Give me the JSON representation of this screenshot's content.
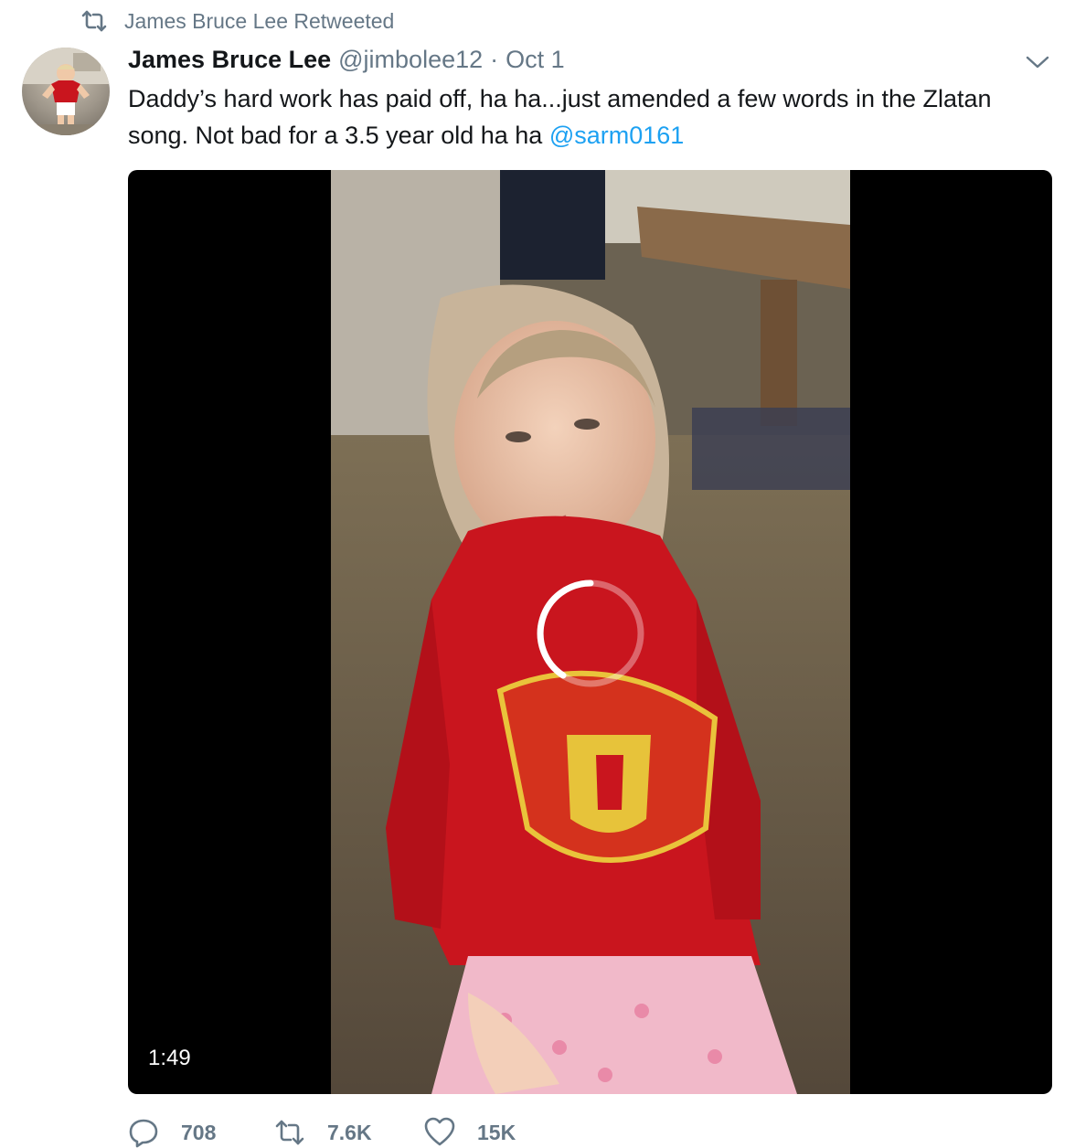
{
  "retweet_context": {
    "label": "James Bruce Lee Retweeted",
    "icon": "retweet-icon"
  },
  "tweet": {
    "author_name": "James Bruce Lee",
    "handle": "@jimbolee12",
    "separator": "·",
    "date": "Oct 1",
    "text_part1": "Daddy’s hard work has paid off, ha ha...just amended a few words in the Zlatan song. Not bad for a 3.5 year old ha ha ",
    "mention": "@sarm0161",
    "video": {
      "duration": "1:49"
    },
    "stats": {
      "replies": "708",
      "retweets": "7.6K",
      "likes": "15K"
    }
  },
  "colors": {
    "link": "#1da1f2",
    "muted": "#657786",
    "text": "#14171a",
    "shirt_red": "#c9151e"
  },
  "icons": [
    "retweet-icon",
    "chevron-down-icon",
    "reply-icon",
    "heart-icon",
    "loading-spinner-icon"
  ]
}
